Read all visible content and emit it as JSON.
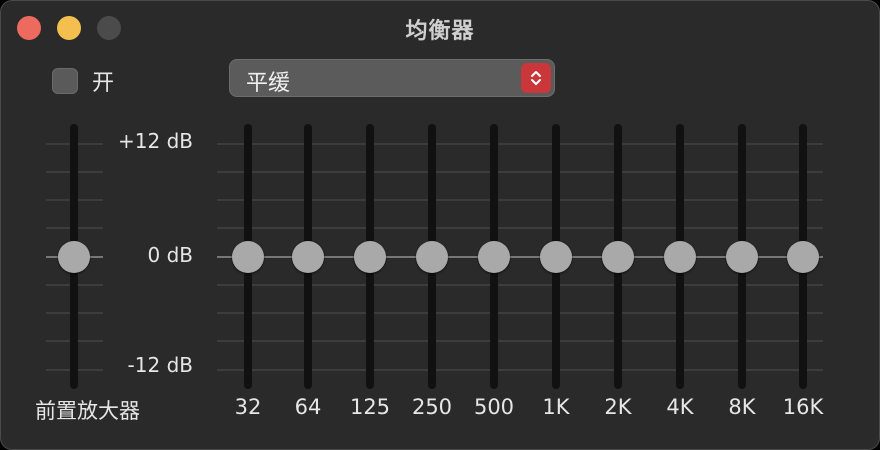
{
  "window": {
    "title": "均衡器"
  },
  "controls": {
    "enabled_label": "开",
    "enabled": false,
    "preset": {
      "value": "平缓",
      "icon": "updown-chevron-icon"
    }
  },
  "db_scale": {
    "max": "+12 dB",
    "zero": "0 dB",
    "min": "-12 dB"
  },
  "preamp": {
    "label": "前置放大器",
    "gain_db": 0
  },
  "bands": [
    {
      "label": "32",
      "gain_db": 0
    },
    {
      "label": "64",
      "gain_db": 0
    },
    {
      "label": "125",
      "gain_db": 0
    },
    {
      "label": "250",
      "gain_db": 0
    },
    {
      "label": "500",
      "gain_db": 0
    },
    {
      "label": "1K",
      "gain_db": 0
    },
    {
      "label": "2K",
      "gain_db": 0
    },
    {
      "label": "4K",
      "gain_db": 0
    },
    {
      "label": "8K",
      "gain_db": 0
    },
    {
      "label": "16K",
      "gain_db": 0
    }
  ],
  "colors": {
    "close": "#ed6a5e",
    "minimize": "#f4bf4f",
    "zoom_disabled": "#4b4b4b",
    "preset_arrows": "#c9373b"
  }
}
